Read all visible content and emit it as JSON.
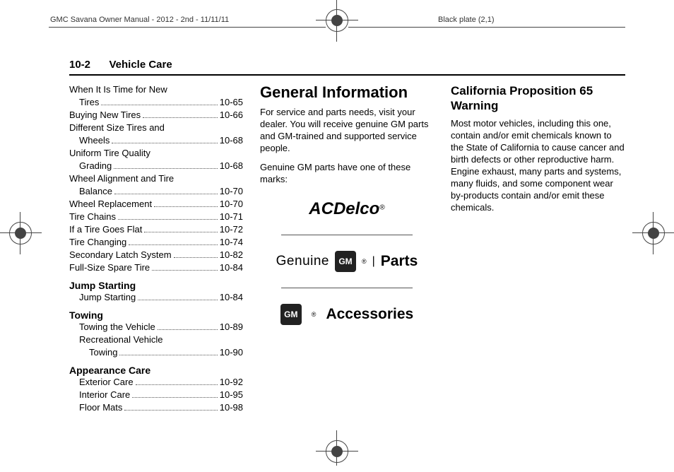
{
  "header": {
    "left": "GMC Savana Owner Manual - 2012 - 2nd - 11/11/11",
    "right": "Black plate (2,1)"
  },
  "section": {
    "page_number": "10-2",
    "title": "Vehicle Care"
  },
  "toc": {
    "items": [
      {
        "label": "When It Is Time for New",
        "cont": "Tires",
        "page": "10-65"
      },
      {
        "label": "Buying New Tires",
        "page": "10-66"
      },
      {
        "label": "Different Size Tires and",
        "cont": "Wheels",
        "page": "10-68"
      },
      {
        "label": "Uniform Tire Quality",
        "cont": "Grading",
        "page": "10-68"
      },
      {
        "label": "Wheel Alignment and Tire",
        "cont": "Balance",
        "page": "10-70"
      },
      {
        "label": "Wheel Replacement",
        "page": "10-70"
      },
      {
        "label": "Tire Chains",
        "page": "10-71"
      },
      {
        "label": "If a Tire Goes Flat",
        "page": "10-72"
      },
      {
        "label": "Tire Changing",
        "page": "10-74"
      },
      {
        "label": "Secondary Latch System",
        "page": "10-82"
      },
      {
        "label": "Full-Size Spare Tire",
        "page": "10-84"
      }
    ],
    "section_jump": {
      "title": "Jump Starting",
      "items": [
        {
          "label": "Jump Starting",
          "page": "10-84"
        }
      ]
    },
    "section_tow": {
      "title": "Towing",
      "items": [
        {
          "label": "Towing the Vehicle",
          "page": "10-89"
        },
        {
          "label": "Recreational Vehicle",
          "cont": "Towing",
          "page": "10-90"
        }
      ]
    },
    "section_appear": {
      "title": "Appearance Care",
      "items": [
        {
          "label": "Exterior Care",
          "page": "10-92"
        },
        {
          "label": "Interior Care",
          "page": "10-95"
        },
        {
          "label": "Floor Mats",
          "page": "10-98"
        }
      ]
    }
  },
  "col2": {
    "heading": "General Information",
    "p1": "For service and parts needs, visit your dealer. You will receive genuine GM parts and GM-trained and supported service people.",
    "p2": "Genuine GM parts have one of these marks:",
    "logos": {
      "acdelco": "ACDelco",
      "acdelco_r": "®",
      "gm_badge": "GM",
      "genuine": "Genuine",
      "bar": "|",
      "parts": "Parts",
      "r": "®",
      "accessories": "Accessories"
    }
  },
  "col3": {
    "heading": "California Proposition 65 Warning",
    "p": "Most motor vehicles, including this one, contain and/or emit chemicals known to the State of California to cause cancer and birth defects or other reproductive harm. Engine exhaust, many parts and systems, many fluids, and some component wear by-products contain and/or emit these chemicals."
  }
}
